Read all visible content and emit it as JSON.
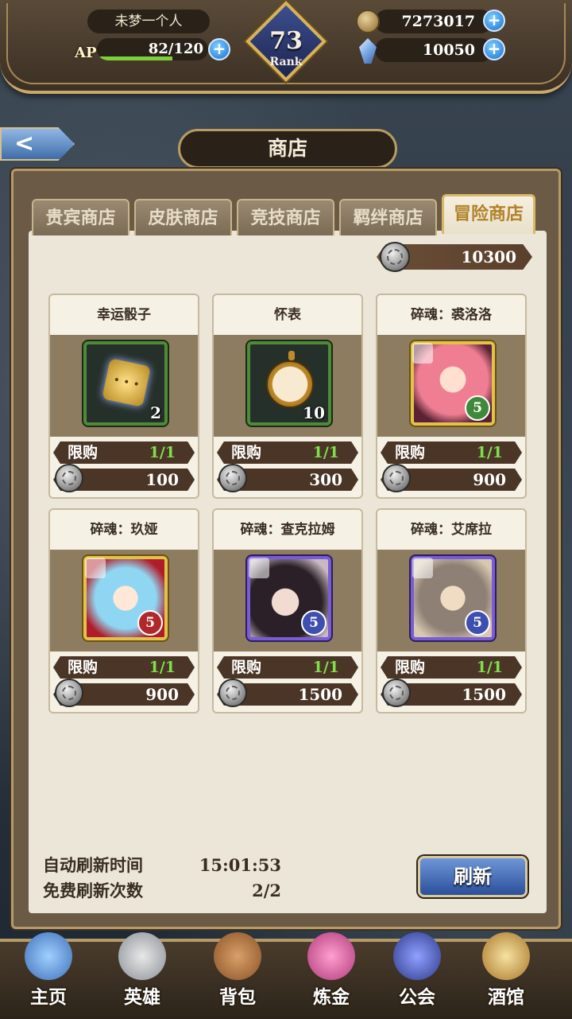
{
  "player": {
    "name": "未梦一个人",
    "ap_label": "AP",
    "ap": "82/120",
    "ap_fraction": 0.68,
    "rank_level": "73",
    "rank_label": "Rank"
  },
  "currency": {
    "gold": "7273017",
    "gems": "10050",
    "plus": "+"
  },
  "nav_back": "<",
  "page_title": "商店",
  "tabs": [
    {
      "label": "贵宾商店",
      "active": false
    },
    {
      "label": "皮肤商店",
      "active": false
    },
    {
      "label": "竞技商店",
      "active": false
    },
    {
      "label": "羁绊商店",
      "active": false
    },
    {
      "label": "冒险商店",
      "active": true
    }
  ],
  "balance": "10300",
  "items": [
    {
      "name": "幸运骰子",
      "qty": "2",
      "limit_label": "限购",
      "limit": "1/1",
      "price": "100",
      "icon": "dice-icon"
    },
    {
      "name": "怀表",
      "qty": "10",
      "limit_label": "限购",
      "limit": "1/1",
      "price": "300",
      "icon": "pocket-watch-icon"
    },
    {
      "name": "碎魂：裘洛洛",
      "qty": "5",
      "limit_label": "限购",
      "limit": "1/1",
      "price": "900",
      "icon": "hero-portrait-icon"
    },
    {
      "name": "碎魂：玖娅",
      "qty": "5",
      "limit_label": "限购",
      "limit": "1/1",
      "price": "900",
      "icon": "hero-portrait-icon"
    },
    {
      "name": "碎魂：查克拉姆",
      "qty": "5",
      "limit_label": "限购",
      "limit": "1/1",
      "price": "1500",
      "icon": "hero-portrait-icon"
    },
    {
      "name": "碎魂：艾席拉",
      "qty": "5",
      "limit_label": "限购",
      "limit": "1/1",
      "price": "1500",
      "icon": "hero-portrait-icon"
    }
  ],
  "refresh": {
    "auto_label": "自动刷新时间",
    "auto_time": "15:01:53",
    "free_label": "免费刷新次数",
    "free_count": "2/2",
    "button": "刷新"
  },
  "bottom_nav": [
    {
      "label": "主页",
      "icon": "castle-icon"
    },
    {
      "label": "英雄",
      "icon": "helmet-icon"
    },
    {
      "label": "背包",
      "icon": "backpack-icon"
    },
    {
      "label": "炼金",
      "icon": "potion-icon"
    },
    {
      "label": "公会",
      "icon": "shield-icon"
    },
    {
      "label": "酒馆",
      "icon": "beer-mug-icon"
    }
  ],
  "colors": {
    "limit_value": "#7fe04a",
    "active_tab_text": "#b0832a",
    "refresh_button": "#2b4f9a"
  }
}
